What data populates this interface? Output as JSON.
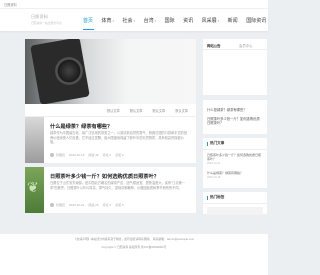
{
  "topbar": {
    "site_name": "日照资料"
  },
  "header": {
    "logo_line1": "日照资料",
    "logo_line2": "日照资料一站式服务平台",
    "nav": [
      {
        "label": "首页",
        "active": true,
        "caret": false
      },
      {
        "label": "体育",
        "active": false,
        "caret": true
      },
      {
        "label": "社会",
        "active": false,
        "caret": true
      },
      {
        "label": "台湾",
        "active": false,
        "caret": true
      },
      {
        "label": "国际",
        "active": false,
        "caret": false
      },
      {
        "label": "资讯",
        "active": false,
        "caret": false
      },
      {
        "label": "风采展",
        "active": false,
        "caret": true
      },
      {
        "label": "新闻",
        "active": false,
        "caret": false
      },
      {
        "label": "国际资讯",
        "active": false,
        "caret": false
      }
    ]
  },
  "category_strip": [
    "默认文章",
    "默认文章",
    "默认文章",
    "默认文章"
  ],
  "posts": [
    {
      "title": "什么是绿茶？绿茶有哪些？",
      "excerpt": "绿茶作为中国最古老、最广泛饮用的茶类之一，以其清新自然的香气、鲜爽甘甜的口感和丰富的营养价值深受人们喜爱。它不经过发酵，最大限度地保留了鲜叶中的天然物质，具有较高的保健价值。",
      "author": "管理员",
      "date": "2020-10-18",
      "views": "阅读 36",
      "comments": "评论 0",
      "likes": "点赞 0"
    },
    {
      "title": "日照茶叶多少钱一斤？如何选购优质日照茶叶？",
      "excerpt": "日照位于山东省东南部，是中国北方著名的绿茶产区，因气候适宜、昼夜温差大，素有“江北第一茶”的美誉。日照茶叶以叶片厚实、香气持久、滋味浓郁著称，价格因品质和季节而有所不同。",
      "author": "管理员",
      "date": "2020-10-21",
      "views": "阅读 29",
      "comments": "评论 0",
      "likes": "点赞 0"
    }
  ],
  "sidebar": {
    "tabs": [
      {
        "label": "网站公告",
        "active": true
      },
      {
        "label": "会员中心",
        "active": false
      }
    ],
    "questions": [
      "什么是绿茶？绿茶有哪些？",
      "日照茶叶多少钱一斤？如何选购优质日照茶叶？"
    ],
    "hot_title": "热门文章",
    "hot_items": [
      {
        "text": "日照茶叶多少钱一斤？如何选购优质日照茶叶？",
        "meta": "2020-10-21"
      },
      {
        "text": "什么是绿茶？绿茶有哪些？",
        "meta": "2020-10-18"
      }
    ],
    "tags_title": "热门标签"
  },
  "footer": {
    "line1": "【友情声明】本站部分内容来源于网络，如有侵权请联系删除。 联系邮箱：admin@example.com",
    "line2": "Copyright © 日照资料 版权所有 鲁ICP备00000000号"
  }
}
